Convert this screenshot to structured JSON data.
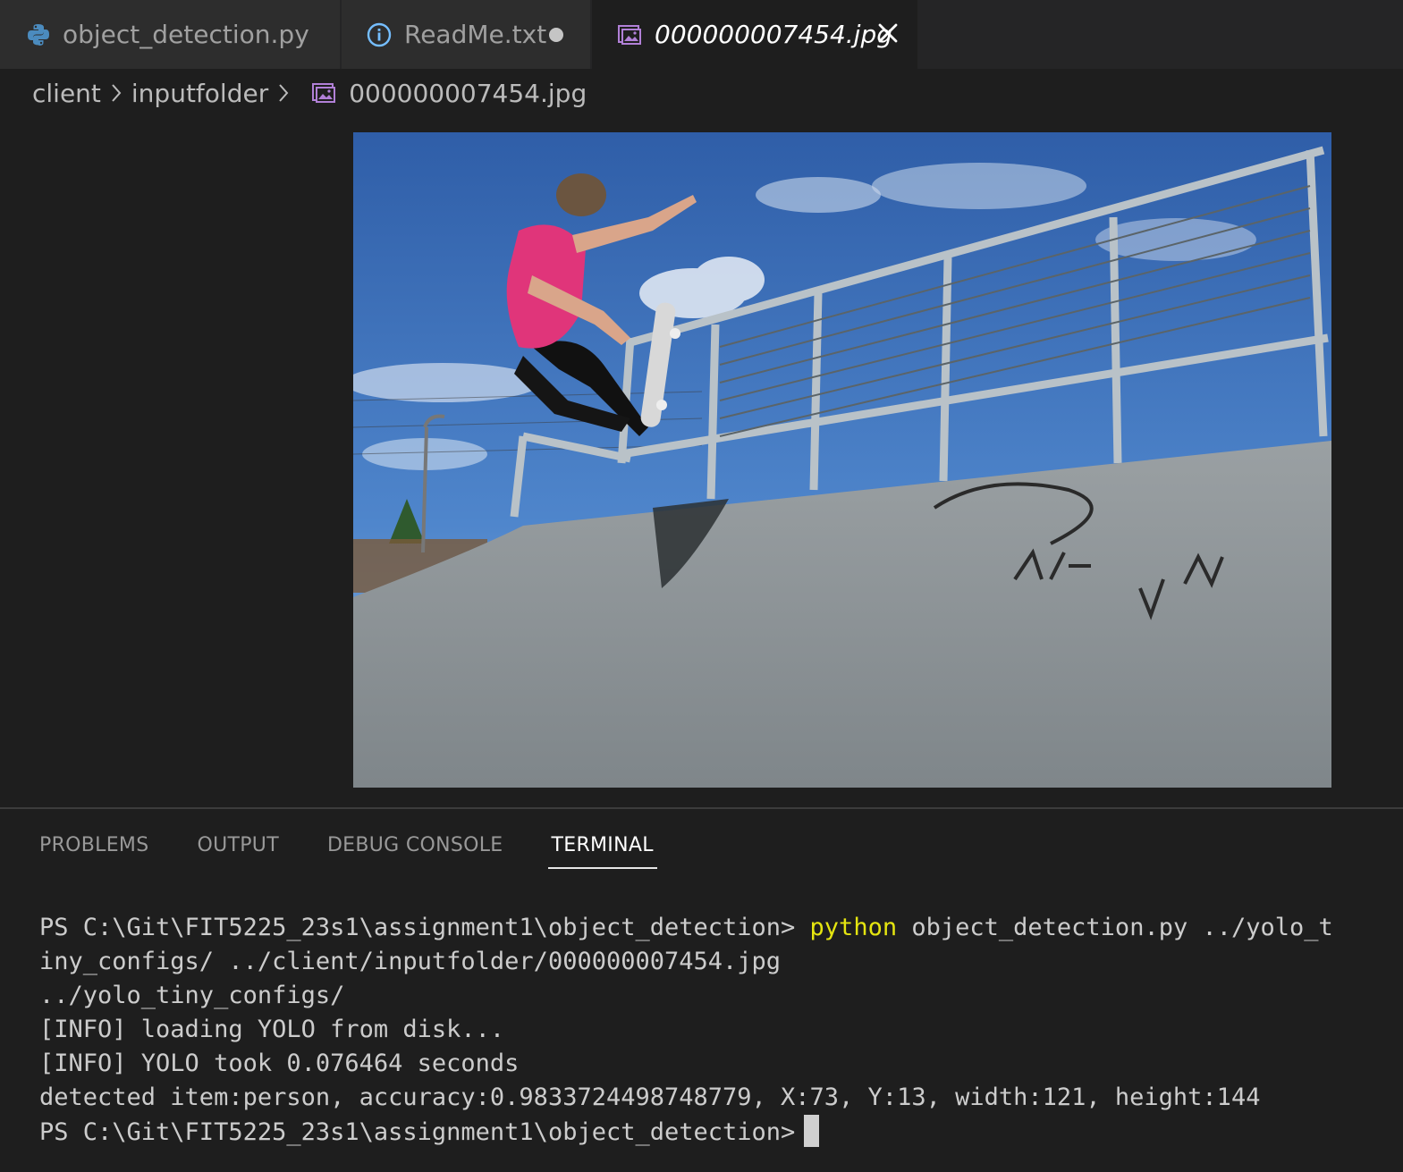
{
  "tabs": [
    {
      "label": "object_detection.py",
      "icon": "python-icon",
      "modified": false,
      "active": false
    },
    {
      "label": "ReadMe.txt",
      "icon": "info-icon",
      "modified": true,
      "active": false
    },
    {
      "label": "000000007454.jpg",
      "icon": "image-file-icon",
      "modified": false,
      "active": true
    }
  ],
  "breadcrumb": {
    "items": [
      "client",
      "inputfolder",
      "000000007454.jpg"
    ]
  },
  "panel": {
    "tabs": [
      "PROBLEMS",
      "OUTPUT",
      "DEBUG CONSOLE",
      "TERMINAL"
    ],
    "active_tab": "TERMINAL"
  },
  "terminal": {
    "prompt": "PS C:\\Git\\FIT5225_23s1\\assignment1\\object_detection>",
    "command": "python",
    "args_line1": "object_detection.py ../yolo_t",
    "args_line2": "iny_configs/ ../client/inputfolder/000000007454.jpg",
    "output": [
      "../yolo_tiny_configs/",
      "[INFO] loading YOLO from disk...",
      "[INFO] YOLO took 0.076464 seconds",
      "detected item:person, accuracy:0.9833724498748779, X:73, Y:13, width:121, height:144"
    ],
    "final_prompt": "PS C:\\Git\\FIT5225_23s1\\assignment1\\object_detection>"
  },
  "colors": {
    "editor_bg": "#1e1e1e",
    "tab_inactive_bg": "#2d2d2d",
    "command_yellow": "#e5e510",
    "python_blue": "#4b8bbe",
    "image_icon_purple": "#b180d7",
    "info_blue": "#75beff"
  }
}
